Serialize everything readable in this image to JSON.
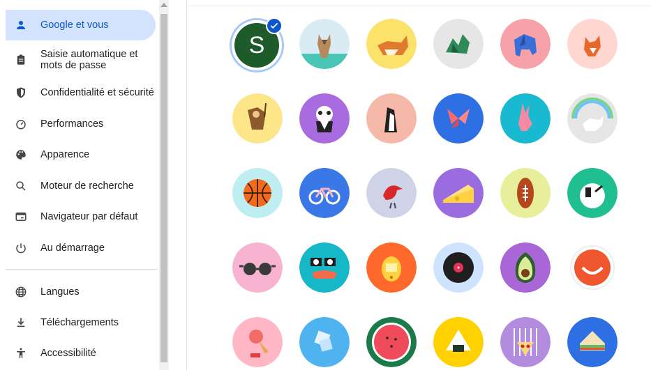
{
  "sidebar": {
    "items": [
      {
        "label": "Google et vous",
        "icon": "person-icon",
        "active": true
      },
      {
        "label": "Saisie automatique et",
        "label2": "mots de passe",
        "icon": "clipboard-icon"
      },
      {
        "label": "Confidentialité et sécurité",
        "icon": "shield-icon"
      },
      {
        "label": "Performances",
        "icon": "speedometer-icon"
      },
      {
        "label": "Apparence",
        "icon": "palette-icon"
      },
      {
        "label": "Moteur de recherche",
        "icon": "search-icon"
      },
      {
        "label": "Navigateur par défaut",
        "icon": "browser-icon"
      },
      {
        "label": "Au démarrage",
        "icon": "power-icon"
      },
      {
        "label": "Langues",
        "icon": "globe-icon"
      },
      {
        "label": "Téléchargements",
        "icon": "download-icon"
      },
      {
        "label": "Accessibilité",
        "icon": "accessibility-icon"
      }
    ]
  },
  "profile": {
    "selected_initial": "S",
    "selected_color": "#1e5b2a",
    "accent": "#0b57d0"
  },
  "avatars": [
    [
      "initial-s",
      "origami-cat",
      "origami-corgi",
      "origami-dragon",
      "origami-elephant",
      "origami-fox"
    ],
    [
      "origami-monkey",
      "origami-panda",
      "origami-penguin",
      "origami-butterfly",
      "origami-rabbit",
      "origami-unicorn"
    ],
    [
      "basketball",
      "bicycle",
      "red-bird",
      "cheese",
      "football",
      "sushi-bowl"
    ],
    [
      "sunglasses",
      "sushi-roll",
      "tamagotchi",
      "vinyl-record",
      "avocado",
      "smile-bowl"
    ],
    [
      "ice-cream",
      "ice",
      "watermelon",
      "onigiri",
      "pizza",
      "sandwich"
    ]
  ]
}
